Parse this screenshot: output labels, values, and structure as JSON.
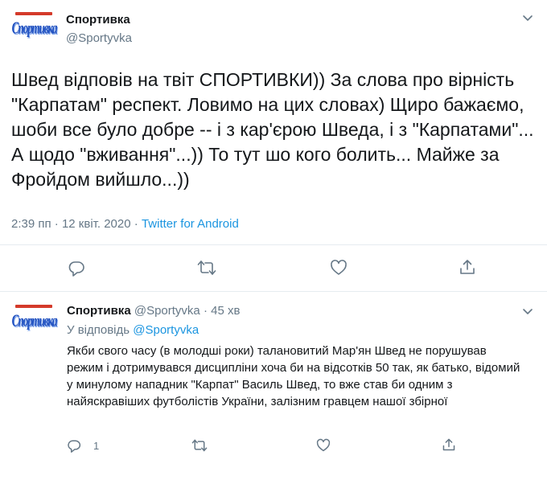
{
  "tweet": {
    "name": "Спортивка",
    "handle": "@Sportyvka",
    "logo_text": "Спортивка",
    "text": "Швед відповів на твіт СПОРТИВКИ)) За слова про вірність \"Карпатам\" респект. Ловимо на цих словах) Щиро бажаємо, шоби все було добре -- і з кар'єрою Шведа, і з \"Карпатами\"... А щодо \"вживання\"...)) То тут шо кого болить... Майже за Фройдом вийшло...))",
    "time": "2:39 пп",
    "date": "12 квіт. 2020",
    "source": "Twitter for Android",
    "separator": "·"
  },
  "reply": {
    "name": "Спортивка",
    "handle": "@Sportyvka",
    "age": "45 хв",
    "separator": "·",
    "reply_label": "У відповідь",
    "reply_handle": "@Sportyvka",
    "logo_text": "Спортивка",
    "text": "Якби свого часу (в молодші роки) талановитий Мар'ян Швед не порушував режим і дотримувався дисципліни хоча би на відсотків 50 так, як батько, відомий у минулому нападник \"Карпат\" Василь Швед, то вже став би одним з найяскравіших футболістів України, залізним гравцем нашої збірної",
    "reply_count": "1"
  },
  "colors": {
    "link": "#1b95e0",
    "muted": "#657786",
    "divider": "#e6ecf0"
  },
  "icons": [
    "chevron-down-icon",
    "reply-icon",
    "retweet-icon",
    "like-icon",
    "share-icon"
  ]
}
